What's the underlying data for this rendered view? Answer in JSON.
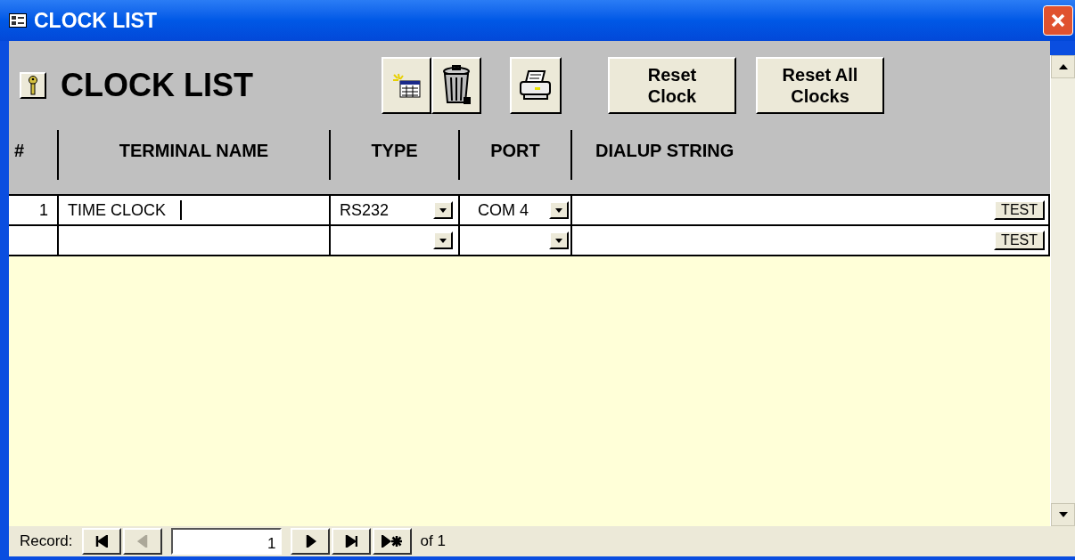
{
  "window": {
    "title": "CLOCK LIST"
  },
  "header": {
    "title": "CLOCK LIST",
    "toolbar": [
      {
        "kind": "new"
      },
      {
        "kind": "delete"
      },
      {
        "kind": "print"
      }
    ],
    "buttons": [
      {
        "label": "Reset\nClock"
      },
      {
        "label": "Reset All\nClocks"
      }
    ]
  },
  "table": {
    "columns": [
      "#",
      "TERMINAL NAME",
      "TYPE",
      "PORT",
      "DIALUP STRING"
    ],
    "rows": [
      {
        "number": "1",
        "terminal_name": "TIME CLOCK",
        "type": "RS232",
        "port": "COM 4",
        "test_button": "TEST",
        "has_cursor": true
      },
      {
        "test_button": "TEST",
        "has_cursor": false
      }
    ]
  },
  "navigation": {
    "label": "Record:",
    "buttons": [
      {
        "kind": "first",
        "disabled": false
      },
      {
        "kind": "prev",
        "disabled": true
      }
    ],
    "current": "1",
    "buttons_after": [
      {
        "kind": "next",
        "disabled": false
      },
      {
        "kind": "last",
        "disabled": false
      },
      {
        "kind": "new",
        "disabled": false
      }
    ],
    "total": "of 1"
  }
}
